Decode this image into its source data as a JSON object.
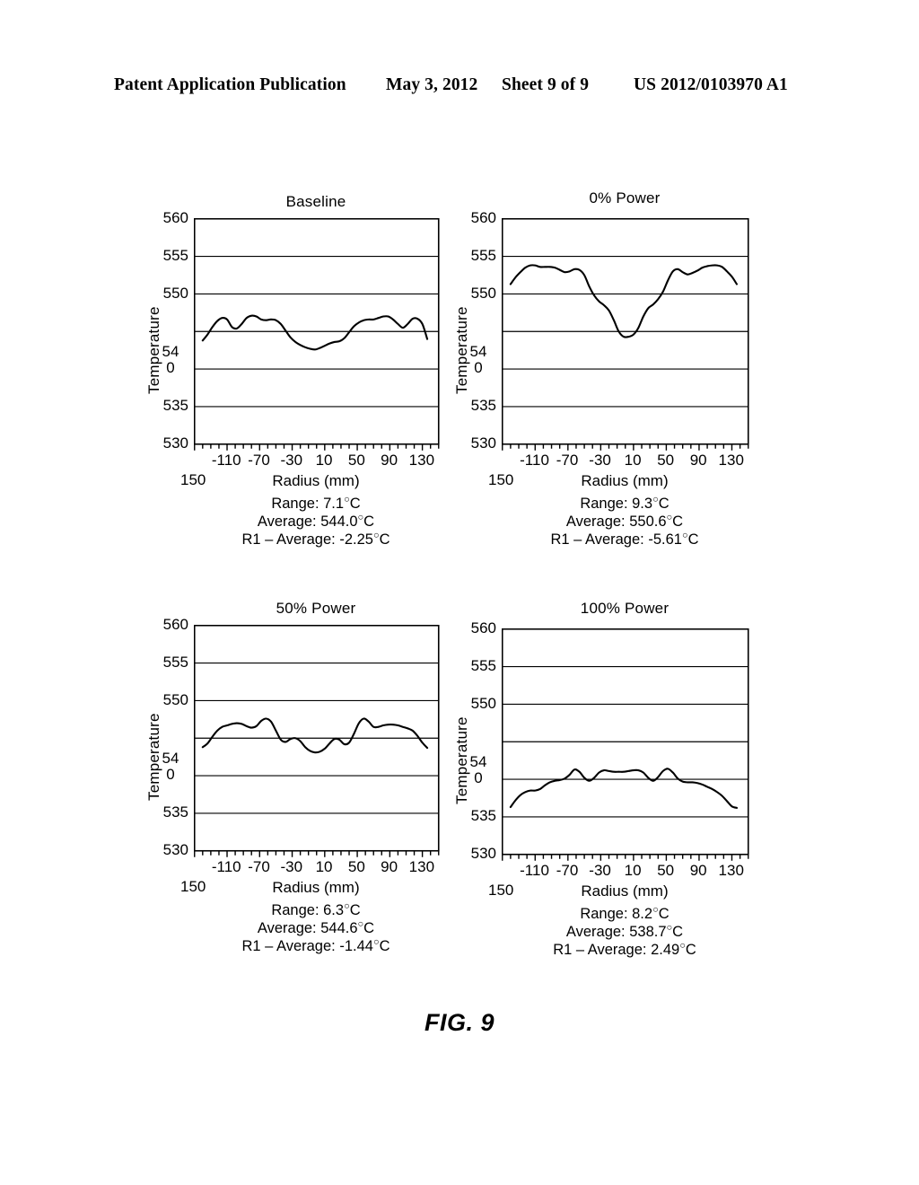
{
  "header": {
    "publication": "Patent Application Publication",
    "date": "May 3, 2012",
    "sheet": "Sheet 9 of 9",
    "number": "US 2012/0103970 A1"
  },
  "figure": {
    "label": "FIG. 9"
  },
  "axes_common": {
    "ylabel": "Temperature",
    "xlabel": "Radius (mm)",
    "yticks": [
      "560",
      "555",
      "550",
      "54",
      "0",
      "535",
      "530"
    ],
    "ytick_values": [
      560,
      555,
      550,
      540,
      535,
      530
    ],
    "xticks": [
      "-110",
      "-70",
      "-30",
      "10",
      "50",
      "90",
      "130"
    ],
    "xtick_first_wrapped": "150",
    "ylim": [
      530,
      560
    ],
    "xlim": [
      -150,
      150
    ],
    "grid": true
  },
  "chart_data": [
    {
      "type": "line",
      "title": "Baseline",
      "xlabel": "Radius (mm)",
      "ylabel": "Temperature",
      "ylim": [
        530,
        560
      ],
      "xlim": [
        -150,
        150
      ],
      "yticks": [
        530,
        535,
        540,
        545,
        550,
        555,
        560
      ],
      "xticks": [
        -150,
        -110,
        -70,
        -30,
        10,
        50,
        90,
        130
      ],
      "grid": true,
      "legend": "none",
      "annotations": {
        "range": "Range: 7.1°C",
        "average": "Average: 544.0°C",
        "r1_average": "R1 – Average: -2.25°C"
      },
      "x": [
        -140,
        -134,
        -128,
        -122,
        -116,
        -110,
        -104,
        -98,
        -92,
        -86,
        -80,
        -74,
        -68,
        -62,
        -56,
        -50,
        -44,
        -38,
        -32,
        -26,
        -20,
        -14,
        -8,
        -2,
        4,
        10,
        16,
        22,
        28,
        34,
        40,
        46,
        52,
        58,
        64,
        70,
        76,
        82,
        88,
        94,
        100,
        106,
        112,
        118,
        124,
        130,
        136
      ],
      "y": [
        543.8,
        544.6,
        545.6,
        546.4,
        546.8,
        546.6,
        545.6,
        545.4,
        546.0,
        546.8,
        547.1,
        547.0,
        546.6,
        546.5,
        546.6,
        546.5,
        546.0,
        545.1,
        544.2,
        543.6,
        543.2,
        542.9,
        542.7,
        542.6,
        542.8,
        543.1,
        543.4,
        543.6,
        543.7,
        544.1,
        544.9,
        545.7,
        546.2,
        546.5,
        546.6,
        546.6,
        546.8,
        547.0,
        547.0,
        546.6,
        546.0,
        545.5,
        546.0,
        546.7,
        546.7,
        546.0,
        544.0
      ]
    },
    {
      "type": "line",
      "title": "0% Power",
      "xlabel": "Radius (mm)",
      "ylabel": "Temperature",
      "ylim": [
        530,
        560
      ],
      "xlim": [
        -150,
        150
      ],
      "yticks": [
        530,
        535,
        540,
        545,
        550,
        555,
        560
      ],
      "xticks": [
        -150,
        -110,
        -70,
        -30,
        10,
        50,
        90,
        130
      ],
      "grid": true,
      "legend": "none",
      "annotations": {
        "range": "Range: 9.3°C",
        "average": "Average: 550.6°C",
        "r1_average": "R1 – Average: -5.61°C"
      },
      "x": [
        -140,
        -134,
        -128,
        -122,
        -116,
        -110,
        -104,
        -98,
        -92,
        -86,
        -80,
        -74,
        -68,
        -62,
        -56,
        -50,
        -44,
        -38,
        -32,
        -26,
        -20,
        -14,
        -8,
        -2,
        4,
        10,
        16,
        22,
        28,
        34,
        40,
        46,
        52,
        58,
        64,
        70,
        76,
        82,
        88,
        94,
        100,
        106,
        112,
        118,
        124,
        130,
        136
      ],
      "y": [
        551.3,
        552.2,
        552.9,
        553.5,
        553.8,
        553.8,
        553.6,
        553.6,
        553.6,
        553.5,
        553.2,
        552.9,
        553.0,
        553.3,
        553.2,
        552.5,
        551.0,
        549.8,
        549.0,
        548.5,
        547.8,
        546.5,
        545.0,
        544.3,
        544.3,
        544.6,
        545.5,
        547.0,
        548.1,
        548.6,
        549.3,
        550.3,
        551.8,
        553.0,
        553.3,
        552.9,
        552.6,
        552.8,
        553.1,
        553.5,
        553.7,
        553.8,
        553.8,
        553.6,
        553.0,
        552.3,
        551.3
      ]
    },
    {
      "type": "line",
      "title": "50% Power",
      "xlabel": "Radius (mm)",
      "ylabel": "Temperature",
      "ylim": [
        530,
        560
      ],
      "xlim": [
        -150,
        150
      ],
      "yticks": [
        530,
        535,
        540,
        545,
        550,
        555,
        560
      ],
      "xticks": [
        -150,
        -110,
        -70,
        -30,
        10,
        50,
        90,
        130
      ],
      "grid": true,
      "legend": "none",
      "annotations": {
        "range": "Range: 6.3°C",
        "average": "Average: 544.6°C",
        "r1_average": "R1 – Average: -1.44°C"
      },
      "x": [
        -140,
        -134,
        -128,
        -122,
        -116,
        -110,
        -104,
        -98,
        -92,
        -86,
        -80,
        -74,
        -68,
        -62,
        -56,
        -50,
        -44,
        -38,
        -32,
        -26,
        -20,
        -14,
        -8,
        -2,
        4,
        10,
        16,
        22,
        28,
        34,
        40,
        46,
        52,
        58,
        64,
        70,
        76,
        82,
        88,
        94,
        100,
        106,
        112,
        118,
        124,
        130,
        136
      ],
      "y": [
        543.8,
        544.3,
        545.2,
        546.0,
        546.5,
        546.7,
        546.9,
        547.0,
        546.9,
        546.6,
        546.4,
        546.6,
        547.3,
        547.6,
        547.2,
        546.0,
        544.8,
        544.5,
        544.9,
        545.0,
        544.6,
        543.8,
        543.3,
        543.1,
        543.2,
        543.6,
        544.3,
        544.9,
        544.8,
        544.2,
        544.4,
        545.6,
        547.0,
        547.6,
        547.2,
        546.5,
        546.5,
        546.7,
        546.8,
        546.8,
        546.7,
        546.5,
        546.3,
        546.0,
        545.3,
        544.4,
        543.7
      ]
    },
    {
      "type": "line",
      "title": "100% Power",
      "xlabel": "Radius (mm)",
      "ylabel": "Temperature",
      "ylim": [
        530,
        560
      ],
      "xlim": [
        -150,
        150
      ],
      "yticks": [
        530,
        535,
        540,
        545,
        550,
        555,
        560
      ],
      "xticks": [
        -150,
        -110,
        -70,
        -30,
        10,
        50,
        90,
        130
      ],
      "grid": true,
      "legend": "none",
      "annotations": {
        "range": "Range: 8.2°C",
        "average": "Average: 538.7°C",
        "r1_average": "R1 – Average: 2.49°C"
      },
      "x": [
        -140,
        -134,
        -128,
        -122,
        -116,
        -110,
        -104,
        -98,
        -92,
        -86,
        -80,
        -74,
        -68,
        -62,
        -56,
        -50,
        -44,
        -38,
        -32,
        -26,
        -20,
        -14,
        -8,
        -2,
        4,
        10,
        16,
        22,
        28,
        34,
        40,
        46,
        52,
        58,
        64,
        70,
        76,
        82,
        88,
        94,
        100,
        106,
        112,
        118,
        124,
        130,
        136
      ],
      "y": [
        536.3,
        537.2,
        537.9,
        538.3,
        538.5,
        538.5,
        538.7,
        539.2,
        539.6,
        539.8,
        539.9,
        540.1,
        540.6,
        541.3,
        541.0,
        540.2,
        539.8,
        540.2,
        540.9,
        541.2,
        541.1,
        541.0,
        541.0,
        541.0,
        541.1,
        541.2,
        541.2,
        540.9,
        540.2,
        539.8,
        540.3,
        541.1,
        541.4,
        540.9,
        540.1,
        539.7,
        539.6,
        539.6,
        539.5,
        539.3,
        539.0,
        538.7,
        538.3,
        537.8,
        537.1,
        536.4,
        536.2
      ]
    }
  ]
}
